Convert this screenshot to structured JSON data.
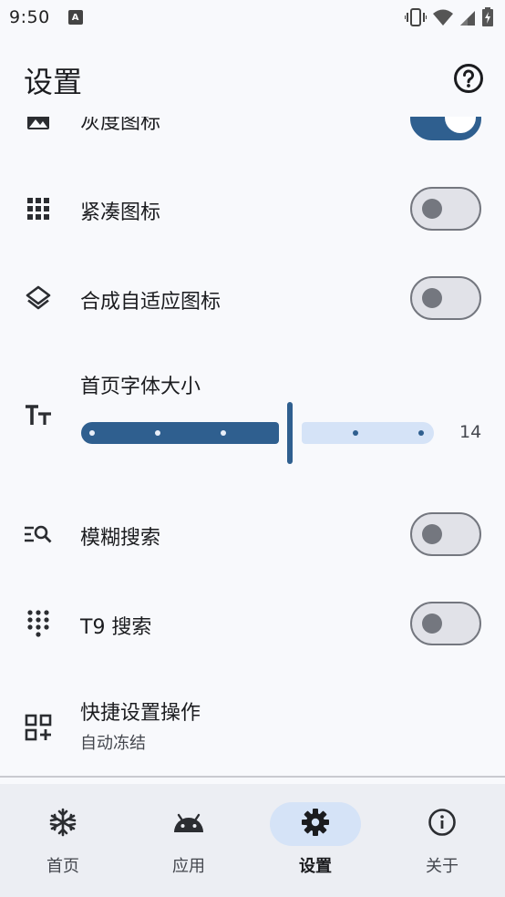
{
  "status_bar": {
    "time": "9:50",
    "app_icon_letter": "A",
    "icons": [
      "vibrate-icon",
      "wifi-icon",
      "signal-icon",
      "battery-charging-icon"
    ]
  },
  "app_bar": {
    "title": "设置",
    "help_icon": "help-circle-icon"
  },
  "settings": {
    "grayscale_icon": {
      "label": "灰度图标",
      "icon": "grayscale-image-icon",
      "enabled": true
    },
    "compact_icon": {
      "label": "紧凑图标",
      "icon": "grid-icon",
      "enabled": false
    },
    "adaptive_icon": {
      "label": "合成自适应图标",
      "icon": "layers-icon",
      "enabled": false
    },
    "font_size": {
      "label": "首页字体大小",
      "icon": "text-size-icon",
      "value": "14",
      "level_fraction": 0.67
    },
    "fuzzy_search": {
      "label": "模糊搜索",
      "icon": "search-list-icon",
      "enabled": false
    },
    "t9_search": {
      "label": "T9 搜索",
      "icon": "dialpad-icon",
      "enabled": false
    },
    "quick_settings": {
      "label": "快捷设置操作",
      "subtitle": "自动冻结",
      "icon": "grid-add-icon"
    }
  },
  "bottom_nav": {
    "items": [
      {
        "label": "首页",
        "icon": "snowflake-icon",
        "active": false
      },
      {
        "label": "应用",
        "icon": "android-icon",
        "active": false
      },
      {
        "label": "设置",
        "icon": "gear-icon",
        "active": true
      },
      {
        "label": "关于",
        "icon": "info-icon",
        "active": false
      }
    ]
  },
  "colors": {
    "accent": "#2f5f8f",
    "accent_container": "#d5e3f7",
    "background": "#f8f9fc",
    "nav_background": "#eceef3",
    "outline": "#74777f"
  }
}
